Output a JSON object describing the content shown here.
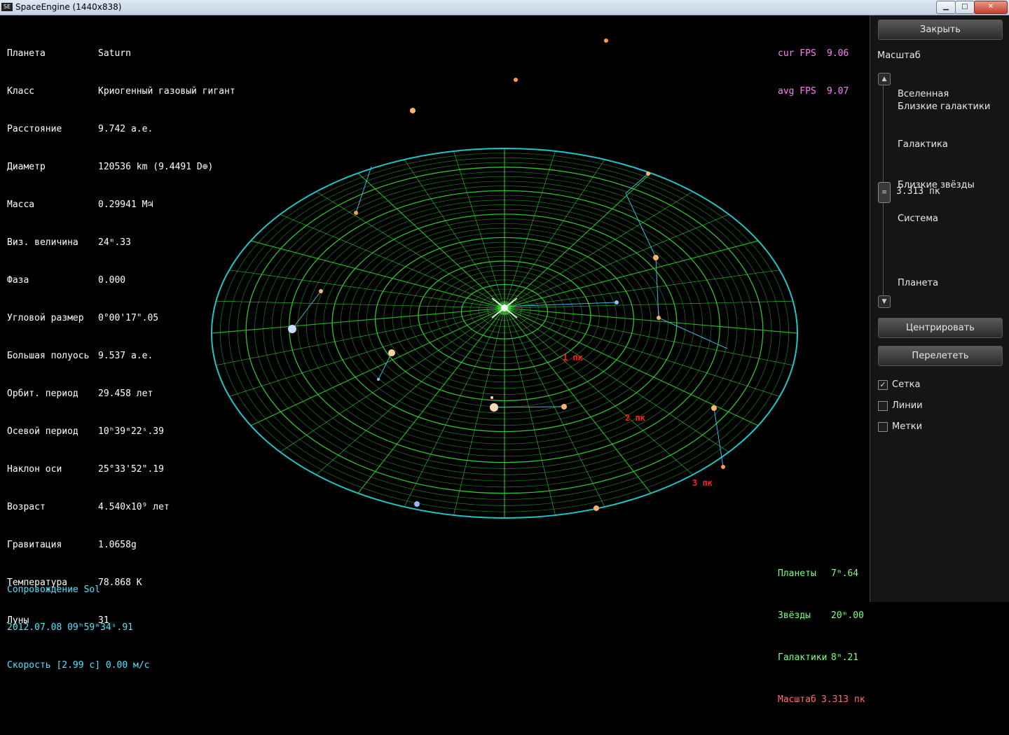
{
  "window": {
    "title": "SpaceEngine (1440x838)",
    "minimize": "▁",
    "maximize": "□",
    "close": "✕"
  },
  "planet_info": [
    {
      "label": "Планета",
      "value": "Saturn"
    },
    {
      "label": "Класс",
      "value": "Криогенный газовый гигант"
    },
    {
      "label": "Расстояние",
      "value": "9.742 а.е."
    },
    {
      "label": "Диаметр",
      "value": "120536 km (9.4491 D⊕)"
    },
    {
      "label": "Масса",
      "value": "0.29941 M♃"
    },
    {
      "label": "Виз. величина",
      "value": "24ᵐ.33"
    },
    {
      "label": "Фаза",
      "value": "0.000"
    },
    {
      "label": "Угловой размер",
      "value": "0°00'17\".05"
    },
    {
      "label": "Большая полуось",
      "value": "9.537 а.е."
    },
    {
      "label": "Орбит. период",
      "value": "29.458 лет"
    },
    {
      "label": "Осевой период",
      "value": "10ʰ39ᵐ22ˢ.39"
    },
    {
      "label": "Наклон оси",
      "value": "25°33'52\".19"
    },
    {
      "label": "Возраст",
      "value": "4.540x10⁹ лет"
    },
    {
      "label": "Гравитация",
      "value": "1.0658g"
    },
    {
      "label": "Температура",
      "value": "78.868 K"
    },
    {
      "label": "Луны",
      "value": "31"
    }
  ],
  "fps": {
    "cur_label": "cur FPS",
    "cur_value": "9.06",
    "avg_label": "avg FPS",
    "avg_value": "9.07"
  },
  "magnitudes": {
    "planets_label": "Планеты",
    "planets_value": "7ᵐ.64",
    "stars_label": "Звёзды",
    "stars_value": "20ᵐ.00",
    "galaxies_label": "Галактики",
    "galaxies_value": "8ᵐ.21",
    "scale_label": "Масштаб",
    "scale_value": "3.313 пк"
  },
  "status": {
    "follow": "Сопровождение Sol",
    "datetime": "2012.07.08 09ʰ59ᵐ34ˢ.91",
    "speed": "Скорость [2.99 c] 0.00 м/с"
  },
  "grid_labels": [
    "1 пк",
    "2 пк",
    "3 пк"
  ],
  "panel": {
    "close_button": "Закрыть",
    "scale_title": "Масштаб",
    "scale_items": [
      "Вселенная",
      "Близкие галактики",
      "Галактика",
      "Близкие звёзды",
      "Система",
      "Планета"
    ],
    "scale_value": "3.313 пк",
    "center_button": "Центрировать",
    "fly_button": "Перелететь",
    "checkboxes": [
      {
        "label": "Сетка",
        "checked": true
      },
      {
        "label": "Линии",
        "checked": false
      },
      {
        "label": "Метки",
        "checked": false
      }
    ]
  },
  "colors": {
    "grid": "#2bd12b",
    "rim": "#1ec7c7",
    "info_text": "#ffffff",
    "fps_text": "#ff7fff",
    "mag_text": "#7fff7f",
    "scale_text": "#ff6f6f",
    "status_text": "#4fe3ff",
    "constellation_line": "#3ab7e8"
  }
}
